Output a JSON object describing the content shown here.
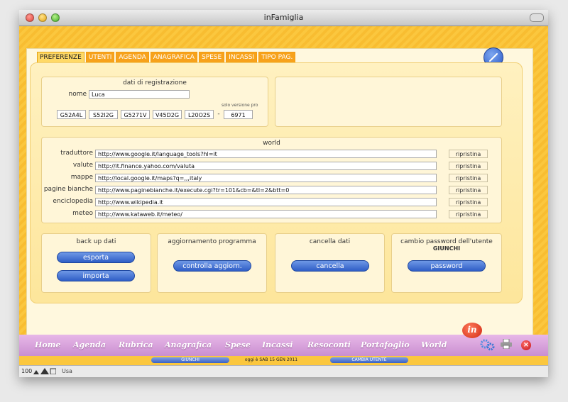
{
  "window": {
    "title": "inFamiglia"
  },
  "tabs": [
    {
      "label": "PREFERENZE",
      "active": true
    },
    {
      "label": "UTENTI"
    },
    {
      "label": "AGENDA"
    },
    {
      "label": "ANAGRAFICA"
    },
    {
      "label": "SPESE"
    },
    {
      "label": "INCASSI"
    },
    {
      "label": "TIPO PAG."
    }
  ],
  "registrazione": {
    "title": "dati di registrazione",
    "name_label": "nome",
    "name_value": "Luca",
    "codes": [
      "G52A4L",
      "S52I2G",
      "G5271V",
      "V45D2G",
      "L20O2S"
    ],
    "separator": "-",
    "pro_label": "solo versione pro",
    "pro_code": "6971"
  },
  "world": {
    "title": "world",
    "reset_label": "ripristina",
    "rows": [
      {
        "label": "traduttore",
        "url": "http://www.google.it/language_tools?hl=it"
      },
      {
        "label": "valute",
        "url": "http://it.finance.yahoo.com/valuta"
      },
      {
        "label": "mappe",
        "url": "http://local.google.it/maps?q=,,,italy"
      },
      {
        "label": "pagine bianche",
        "url": "http://www.paginebianche.it/execute.cgi?tr=101&cb=&tl=2&btt=0"
      },
      {
        "label": "enciclopedia",
        "url": "http://www.wikipedia.it"
      },
      {
        "label": "meteo",
        "url": "http://www.kataweb.it/meteo/"
      }
    ]
  },
  "backup": {
    "title": "back up dati",
    "export_label": "esporta",
    "import_label": "importa"
  },
  "update": {
    "title": "aggiornamento programma",
    "button_label": "controlla aggiorn."
  },
  "delete": {
    "title": "cancella dati",
    "button_label": "cancella"
  },
  "password": {
    "title": "cambio password dell'utente",
    "user": "GIUNCHI",
    "button_label": "password"
  },
  "nav": [
    "Home",
    "Agenda",
    "Rubrica",
    "Anagrafica",
    "Spese",
    "Incassi",
    "Resoconti",
    "Portafoglio",
    "World"
  ],
  "logo_text": "in",
  "status": {
    "user": "GIUNCHI",
    "today_label": "oggi è",
    "date": "SAB 15 GEN 2011",
    "change_user": "CAMBIA UTENTE"
  },
  "footer": {
    "zoom": "100",
    "mode": "Usa"
  },
  "colors": {
    "background": "#fbc73e",
    "tab": "#f7a21b",
    "nav": "#d9a3dd",
    "button": "#3a67c9"
  },
  "icons": [
    "edit-pencil-icon",
    "in-logo-icon",
    "gear-icon",
    "print-icon",
    "close-icon"
  ]
}
